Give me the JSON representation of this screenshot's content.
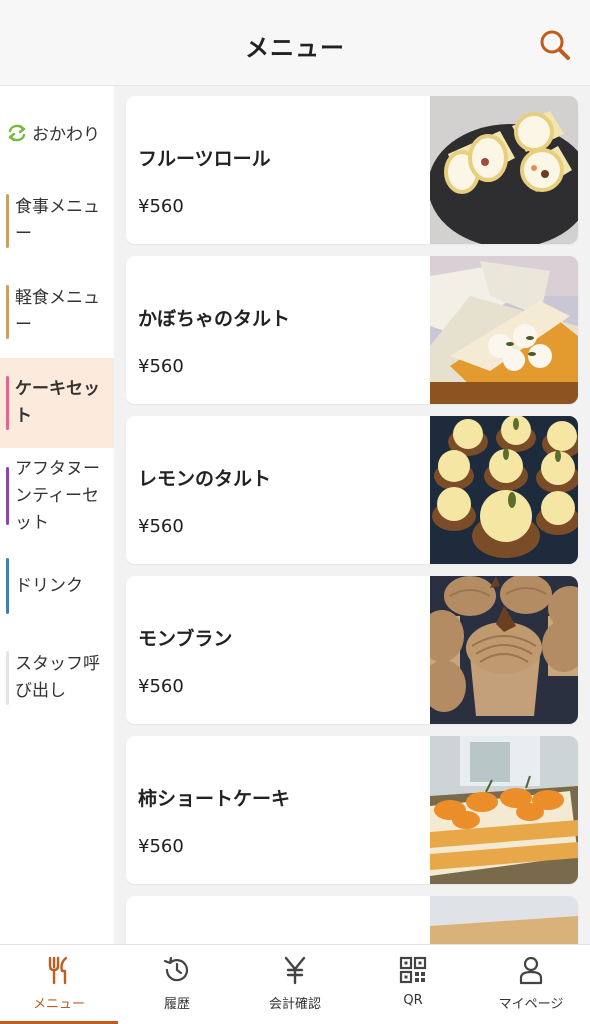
{
  "header": {
    "title": "メニュー",
    "search_icon": "search-icon"
  },
  "sidebar": {
    "refill": {
      "label": "おかわり",
      "icon": "refresh-icon",
      "color": "#79b843"
    },
    "categories": [
      {
        "label": "食事メニュー",
        "color": "#c9a165",
        "active": false
      },
      {
        "label": "軽食メニュー",
        "color": "#c9a165",
        "active": false
      },
      {
        "label": "ケーキセット",
        "color": "#e2688a",
        "active": true
      },
      {
        "label": "アフタヌーンティーセット",
        "color": "#8a47ae",
        "active": false
      },
      {
        "label": "ドリンク",
        "color": "#3f7fb4",
        "active": false
      },
      {
        "label": "スタッフ呼び出し",
        "color": "#e4e4e4",
        "active": false
      }
    ]
  },
  "items": [
    {
      "name": "フルーツロール",
      "price": "¥560",
      "photo": "fruit-roll-cake-photo"
    },
    {
      "name": "かぼちゃのタルト",
      "price": "¥560",
      "photo": "pumpkin-tart-photo"
    },
    {
      "name": "レモンのタルト",
      "price": "¥560",
      "photo": "lemon-tart-photo"
    },
    {
      "name": "モンブラン",
      "price": "¥560",
      "photo": "mont-blanc-photo"
    },
    {
      "name": "柿ショートケーキ",
      "price": "¥560",
      "photo": "persimmon-shortcake-photo"
    },
    {
      "name": "",
      "price": "",
      "photo": "partial-item-photo"
    }
  ],
  "tabbar": {
    "accent": "#c05c1d",
    "tabs": [
      {
        "label": "メニュー",
        "icon": "fork-knife-icon",
        "active": true
      },
      {
        "label": "履歴",
        "icon": "history-icon",
        "active": false
      },
      {
        "label": "会計確認",
        "icon": "yen-icon",
        "active": false
      },
      {
        "label": "QR",
        "icon": "qr-code-icon",
        "active": false
      },
      {
        "label": "マイページ",
        "icon": "person-icon",
        "active": false
      }
    ]
  }
}
